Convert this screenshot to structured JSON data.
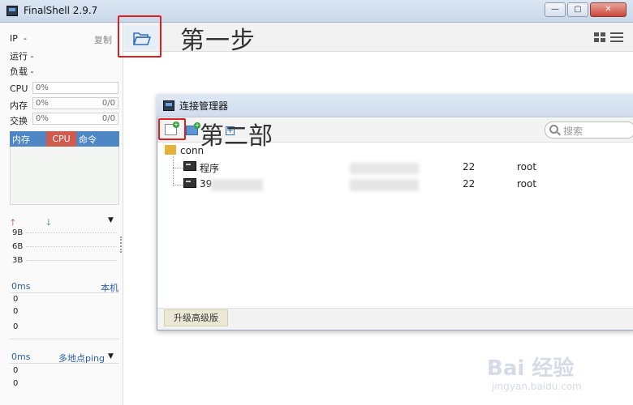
{
  "app": {
    "title": "FinalShell 2.9.7"
  },
  "window_controls": {
    "minimize": "—",
    "maximize": "▢",
    "close": "✕"
  },
  "sidebar": {
    "ip_label": "IP",
    "ip_value": "-",
    "copy_label": "复制",
    "run_label": "运行 -",
    "load_label": "负载 -",
    "cpu_label": "CPU",
    "cpu_value": "0%",
    "mem_label": "内存",
    "mem_value": "0%",
    "mem_amount": "0/0",
    "swap_label": "交换",
    "swap_value": "0%",
    "swap_amount": "0/0",
    "tabs": [
      "内存",
      "CPU",
      "命令"
    ],
    "net_labels": [
      "9B",
      "6B",
      "3B"
    ],
    "latency_label": "0ms",
    "local_label": "本机",
    "latency_values": [
      "0",
      "0",
      "0"
    ],
    "ping_latency_label": "0ms",
    "ping_label": "多地点ping",
    "ping_values": [
      "0",
      "0"
    ]
  },
  "annotations": {
    "step1": "第一步",
    "step2": "第二部"
  },
  "dialog": {
    "title": "连接管理器",
    "search_placeholder": "搜索",
    "folder": "conn",
    "rows": [
      {
        "name": "程序",
        "port": "22",
        "user": "root"
      },
      {
        "name": "39",
        "port": "22",
        "user": "root"
      }
    ],
    "upgrade_button": "升级高级版"
  },
  "watermark": {
    "logo": "Bai 经验",
    "url": "jingyan.baidu.com"
  },
  "colors": {
    "tab_bar": "#4f86c5",
    "tab_active": "#cf5b4f",
    "highlight_box": "#e02020"
  }
}
